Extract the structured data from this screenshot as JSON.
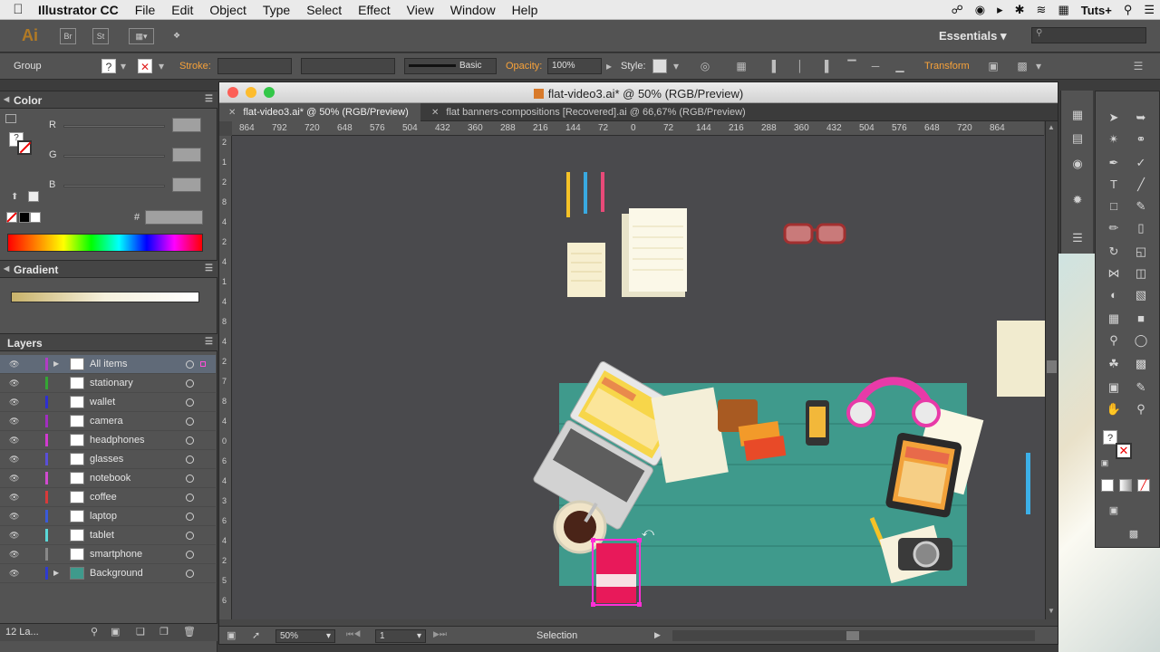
{
  "menubar": {
    "app": "Illustrator CC",
    "items": [
      "File",
      "Edit",
      "Object",
      "Type",
      "Select",
      "Effect",
      "View",
      "Window",
      "Help"
    ],
    "right_label": "Tuts+"
  },
  "appbar": {
    "logo": "Ai",
    "bridge": "Br",
    "stock": "St",
    "workspace": "Essentials"
  },
  "control": {
    "group": "Group",
    "stroke_label": "Stroke:",
    "brush": "Basic",
    "opacity_label": "Opacity:",
    "opacity_value": "100%",
    "style_label": "Style:",
    "transform": "Transform"
  },
  "color_panel": {
    "title": "Color",
    "channels": [
      "R",
      "G",
      "B"
    ],
    "hex_label": "#"
  },
  "gradient_panel": {
    "title": "Gradient"
  },
  "layers_panel": {
    "title": "Layers",
    "count": "12 La...",
    "layers": [
      {
        "name": "All items",
        "color": "#b23cc5",
        "expandable": true,
        "selected": true
      },
      {
        "name": "stationary",
        "color": "#34a734",
        "expandable": false,
        "selected": false
      },
      {
        "name": "wallet",
        "color": "#2e2fd0",
        "expandable": false,
        "selected": false
      },
      {
        "name": "camera",
        "color": "#a12ec0",
        "expandable": false,
        "selected": false
      },
      {
        "name": "headphones",
        "color": "#d13ad0",
        "expandable": false,
        "selected": false
      },
      {
        "name": "glasses",
        "color": "#5a4fd8",
        "expandable": false,
        "selected": false
      },
      {
        "name": "notebook",
        "color": "#d14ad0",
        "expandable": false,
        "selected": false
      },
      {
        "name": "coffee",
        "color": "#d83a3a",
        "expandable": false,
        "selected": false
      },
      {
        "name": "laptop",
        "color": "#3a5ad8",
        "expandable": false,
        "selected": false
      },
      {
        "name": "tablet",
        "color": "#5ad8d8",
        "expandable": false,
        "selected": false
      },
      {
        "name": "smartphone",
        "color": "#888888",
        "expandable": false,
        "selected": false
      },
      {
        "name": "Background",
        "color": "#2e3bd0",
        "expandable": true,
        "selected": false
      }
    ]
  },
  "document": {
    "title": "flat-video3.ai* @ 50% (RGB/Preview)",
    "tabs": [
      {
        "label": "flat-video3.ai* @ 50% (RGB/Preview)",
        "active": true
      },
      {
        "label": "flat banners-compositions [Recovered].ai @ 66,67% (RGB/Preview)",
        "active": false
      }
    ],
    "ruler_h": [
      "864",
      "792",
      "720",
      "648",
      "576",
      "504",
      "432",
      "360",
      "288",
      "216",
      "144",
      "72",
      "0",
      "72",
      "144",
      "216",
      "288",
      "360",
      "432",
      "504",
      "576",
      "648",
      "720",
      "864"
    ],
    "ruler_v": [
      "2",
      "1",
      "2",
      "8",
      "4",
      "2",
      "4",
      "1",
      "4",
      "8",
      "4",
      "2",
      "7",
      "8",
      "4",
      "0",
      "6",
      "4",
      "3",
      "6",
      "4",
      "2",
      "5",
      "6"
    ]
  },
  "status": {
    "zoom": "50%",
    "page": "1",
    "tool": "Selection"
  },
  "colors": {
    "desk": "#3f9a8c",
    "accent_magenta": "#ff2fd6",
    "panel": "#535353"
  }
}
